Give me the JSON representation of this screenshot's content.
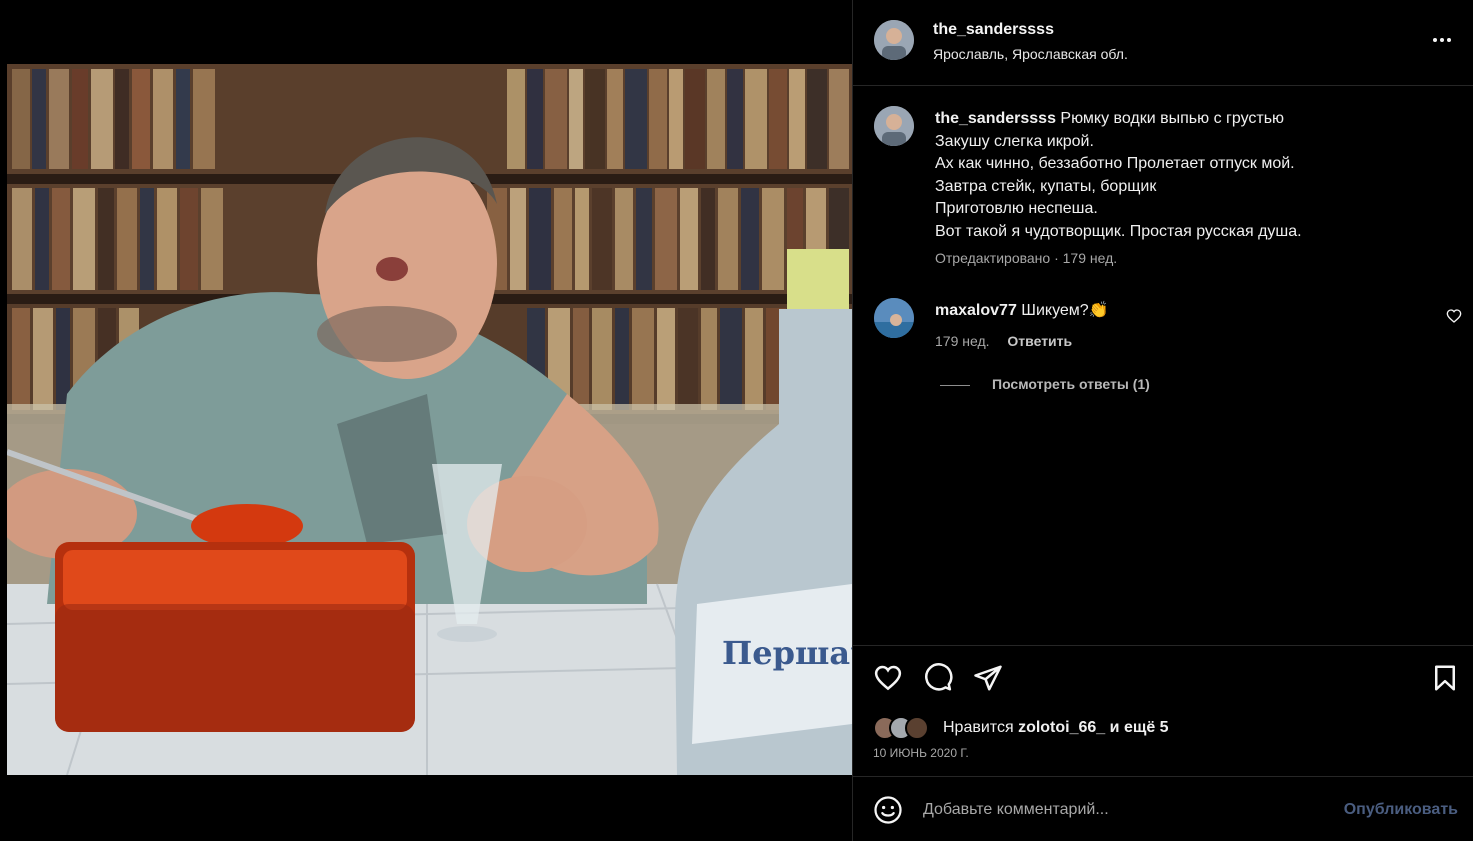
{
  "post": {
    "username": "the_sanderssss",
    "location": "Ярославль, Ярославская обл."
  },
  "caption": {
    "username": "the_sanderssss",
    "lines": [
      "Рюмку водки выпью с грустью",
      "Закушу слегка икрой.",
      "Ах как чинно, беззаботно Пролетает отпуск мой.",
      "Завтра стейк, купаты, борщик",
      "Приготовлю неспеша.",
      "Вот такой я чудотворщик. Простая русская душа."
    ],
    "meta": "Отредактировано · 179 нед."
  },
  "comments": [
    {
      "username": "maxalov77",
      "text": "Шикуем?👏",
      "time": "179 нед.",
      "reply_label": "Ответить"
    }
  ],
  "view_replies": "Посмотреть ответы (1)",
  "likes": {
    "prefix": "Нравится",
    "user": "zolotoi_66_",
    "suffix": "и ещё 5"
  },
  "date": "10 ИЮНЬ 2020 Г.",
  "comment_input": {
    "placeholder": "Добавьте комментарий..."
  },
  "publish_label": "Опубликовать",
  "photo": {
    "bottle_label": "Першачо"
  },
  "icons": {
    "more": "more-horizontal-icon",
    "like": "heart-icon",
    "comment": "comment-icon",
    "share": "send-icon",
    "save": "bookmark-icon",
    "emoji": "emoji-icon"
  },
  "colors": {
    "background": "#000000",
    "text": "#f5f5f5",
    "secondary_text": "#a8a8a8",
    "divider": "#262626",
    "publish_disabled": "#4a5d80"
  }
}
